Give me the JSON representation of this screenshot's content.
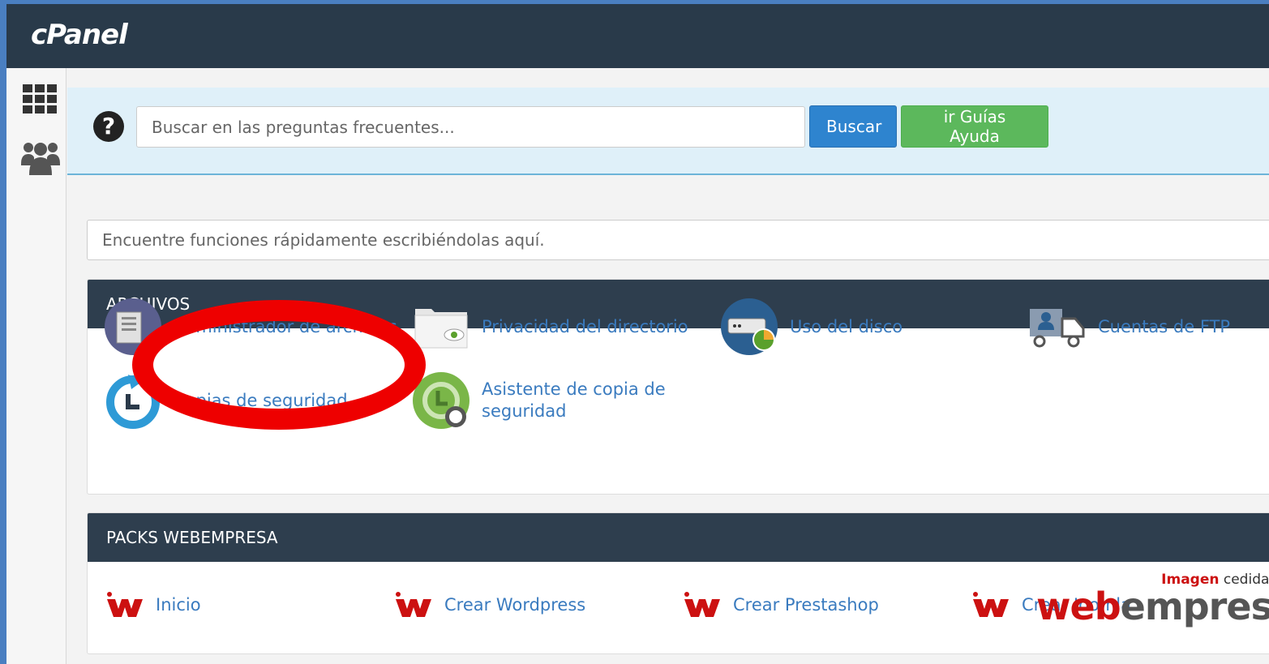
{
  "header": {
    "logo": "cPanel"
  },
  "help": {
    "placeholder": "Buscar en las preguntas frecuentes...",
    "search_button": "Buscar",
    "guides_button": "ir Guías Ayuda"
  },
  "quick_search": {
    "placeholder": "Encuentre funciones rápidamente escribiéndolas aquí."
  },
  "archivos": {
    "title": "ARCHIVOS",
    "items": [
      {
        "label": "Administrador de archivos",
        "icon": "file-manager-icon"
      },
      {
        "label": "Privacidad del directorio",
        "icon": "directory-privacy-icon"
      },
      {
        "label": "Uso del disco",
        "icon": "disk-usage-icon"
      },
      {
        "label": "Cuentas de FTP",
        "icon": "ftp-accounts-icon"
      },
      {
        "label": "Copias de seguridad",
        "icon": "backup-icon"
      },
      {
        "label": "Asistente de copia de seguridad",
        "icon": "backup-wizard-icon"
      }
    ]
  },
  "packs": {
    "title": "PACKS WEBEMPRESA",
    "items": [
      {
        "label": "Inicio",
        "icon": "webempresa-icon"
      },
      {
        "label": "Crear Wordpress",
        "icon": "webempresa-icon"
      },
      {
        "label": "Crear Prestashop",
        "icon": "webempresa-icon"
      },
      {
        "label": "Crear Joomla",
        "icon": "webempresa-icon"
      }
    ]
  },
  "watermark": {
    "word1": "Imagen",
    "rest": " cedida por",
    "logo_a": "web",
    "logo_b": "empresa"
  },
  "colors": {
    "topbar": "#293a4a",
    "link": "#3a7bbf",
    "highlight": "#ee0000",
    "blue_button": "#2e84cf",
    "green_button": "#5cb85c"
  }
}
